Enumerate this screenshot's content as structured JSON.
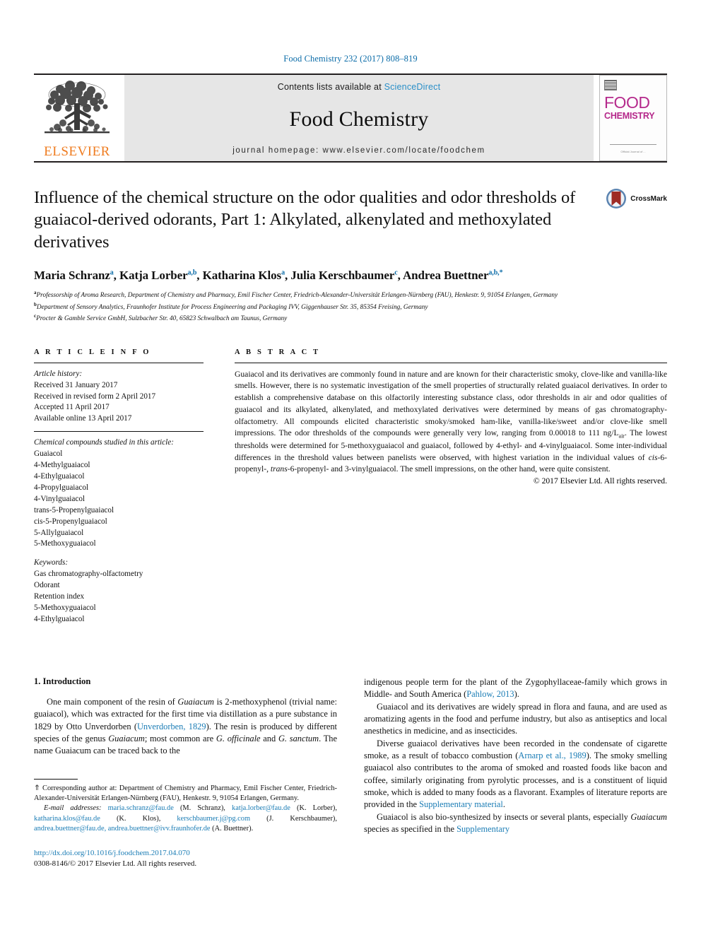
{
  "running_head": "Food Chemistry 232 (2017) 808–819",
  "masthead": {
    "publisher_logo_text": "ELSEVIER",
    "contents_prefix": "Contents lists available at",
    "contents_link": "ScienceDirect",
    "journal_title": "Food Chemistry",
    "homepage_label": "journal homepage: www.elsevier.com/locate/foodchem",
    "cover": {
      "line1": "FOOD",
      "line2": "CHEMISTRY",
      "footer": "Official Journal of ..."
    }
  },
  "title": "Influence of the chemical structure on the odor qualities and odor thresholds of guaiacol-derived odorants, Part 1: Alkylated, alkenylated and methoxylated derivatives",
  "crossmark_label": "CrossMark",
  "authors": [
    {
      "name": "Maria Schranz",
      "marks": "a"
    },
    {
      "name": "Katja Lorber",
      "marks": "a,b"
    },
    {
      "name": "Katharina Klos",
      "marks": "a"
    },
    {
      "name": "Julia Kerschbaumer",
      "marks": "c"
    },
    {
      "name": "Andrea Buettner",
      "marks": "a,b,*"
    }
  ],
  "affiliations": [
    {
      "mark": "a",
      "text": "Professorship of Aroma Research, Department of Chemistry and Pharmacy, Emil Fischer Center, Friedrich-Alexander-Universität Erlangen-Nürnberg (FAU), Henkestr. 9, 91054 Erlangen, Germany"
    },
    {
      "mark": "b",
      "text": "Department of Sensory Analytics, Fraunhofer Institute for Process Engineering and Packaging IVV, Giggenhauser Str. 35, 85354 Freising, Germany"
    },
    {
      "mark": "c",
      "text": "Procter & Gamble Service GmbH, Sulzbacher Str. 40, 65823 Schwalbach am Taunus, Germany"
    }
  ],
  "article_info": {
    "heading": "A R T I C L E   I N F O",
    "history_label": "Article history:",
    "history": [
      "Received 31 January 2017",
      "Received in revised form 2 April 2017",
      "Accepted 11 April 2017",
      "Available online 13 April 2017"
    ],
    "compounds_label": "Chemical compounds studied in this article:",
    "compounds": [
      "Guaiacol",
      "4-Methylguaiacol",
      "4-Ethylguaiacol",
      "4-Propylguaiacol",
      "4-Vinylguaiacol",
      "trans-5-Propenylguaiacol",
      "cis-5-Propenylguaiacol",
      "5-Allylguaiacol",
      "5-Methoxyguaiacol"
    ],
    "keywords_label": "Keywords:",
    "keywords": [
      "Gas chromatography-olfactometry",
      "Odorant",
      "Retention index",
      "5-Methoxyguaiacol",
      "4-Ethylguaiacol"
    ]
  },
  "abstract": {
    "heading": "A B S T R A C T",
    "text": "Guaiacol and its derivatives are commonly found in nature and are known for their characteristic smoky, clove-like and vanilla-like smells. However, there is no systematic investigation of the smell properties of structurally related guaiacol derivatives. In order to establish a comprehensive database on this olfactorily interesting substance class, odor thresholds in air and odor qualities of guaiacol and its alkylated, alkenylated, and methoxylated derivatives were determined by means of gas chromatography-olfactometry. All compounds elicited characteristic smoky/smoked ham-like, vanilla-like/sweet and/or clove-like smell impressions. The odor thresholds of the compounds were generally very low, ranging from 0.00018 to 111 ng/Lair. The lowest thresholds were determined for 5-methoxyguaiacol and guaiacol, followed by 4-ethyl- and 4-vinylguaiacol. Some inter-individual differences in the threshold values between panelists were observed, with highest variation in the individual values of cis-6-propenyl-, trans-6-propenyl- and 3-vinylguaiacol. The smell impressions, on the other hand, were quite consistent.",
    "copyright": "© 2017 Elsevier Ltd. All rights reserved."
  },
  "introduction": {
    "heading": "1. Introduction",
    "left_paragraph_1": "One main component of the resin of Guaiacum is 2-methoxyphenol (trivial name: guaiacol), which was extracted for the first time via distillation as a pure substance in 1829 by Otto Unverdorben (Unverdorben, 1829). The resin is produced by different species of the genus Guaiacum; most common are G. officinale and G. sanctum. The name Guaiacum can be traced back to the",
    "right_paragraph_1": "indigenous people term for the plant of the Zygophyllaceae-family which grows in Middle- and South America (Pahlow, 2013).",
    "right_paragraph_2": "Guaiacol and its derivatives are widely spread in flora and fauna, and are used as aromatizing agents in the food and perfume industry, but also as antiseptics and local anesthetics in medicine, and as insecticides.",
    "right_paragraph_3": "Diverse guaiacol derivatives have been recorded in the condensate of cigarette smoke, as a result of tobacco combustion (Arnarp et al., 1989). The smoky smelling guaiacol also contributes to the aroma of smoked and roasted foods like bacon and coffee, similarly originating from pyrolytic processes, and is a constituent of liquid smoke, which is added to many foods as a flavorant. Examples of literature reports are provided in the Supplementary material.",
    "right_paragraph_4": "Guaiacol is also bio-synthesized by insects or several plants, especially Guaiacum species as specified in the Supplementary",
    "links": {
      "unverdorben": "Unverdorben, 1829",
      "pahlow": "Pahlow, 2013",
      "arnarp_1": "Arnarp",
      "arnarp_2": "et al., 1989",
      "supp_material": "Supplementary material",
      "supp_trailing": "Supplementary"
    }
  },
  "footnote": {
    "star": "⇑",
    "corresponding": "Corresponding author at: Department of Chemistry and Pharmacy, Emil Fischer Center, Friedrich-Alexander-Universität Erlangen-Nürnberg (FAU), Henkestr. 9, 91054 Erlangen, Germany.",
    "email_label": "E-mail addresses:",
    "emails": [
      {
        "address": "maria.schranz@fau.de",
        "person": "(M. Schranz)"
      },
      {
        "address": "katja.lorber@fau.de",
        "person": "(K. Lorber)"
      },
      {
        "address": "katharina.klos@fau.de",
        "person": "(K. Klos)"
      },
      {
        "address": "kerschbaumer.j@pg.com",
        "person": "(J. Kerschbaumer)"
      },
      {
        "address": "andrea.buettner@fau.de, andrea.buettner@ivv.fraunhofer.de",
        "person": "(A. Buettner)"
      }
    ]
  },
  "footer": {
    "doi": "http://dx.doi.org/10.1016/j.foodchem.2017.04.070",
    "rights": "0308-8146/© 2017 Elsevier Ltd. All rights reserved."
  },
  "colors": {
    "link": "#1a7cb5",
    "running_head": "#0b6ca8",
    "elsevier_orange": "#ef7c20",
    "cover_magenta": "#b5278a",
    "banner_bg": "#e6e6e6",
    "crossmark_blue": "#4a76a8",
    "crossmark_red": "#9e2b25"
  }
}
